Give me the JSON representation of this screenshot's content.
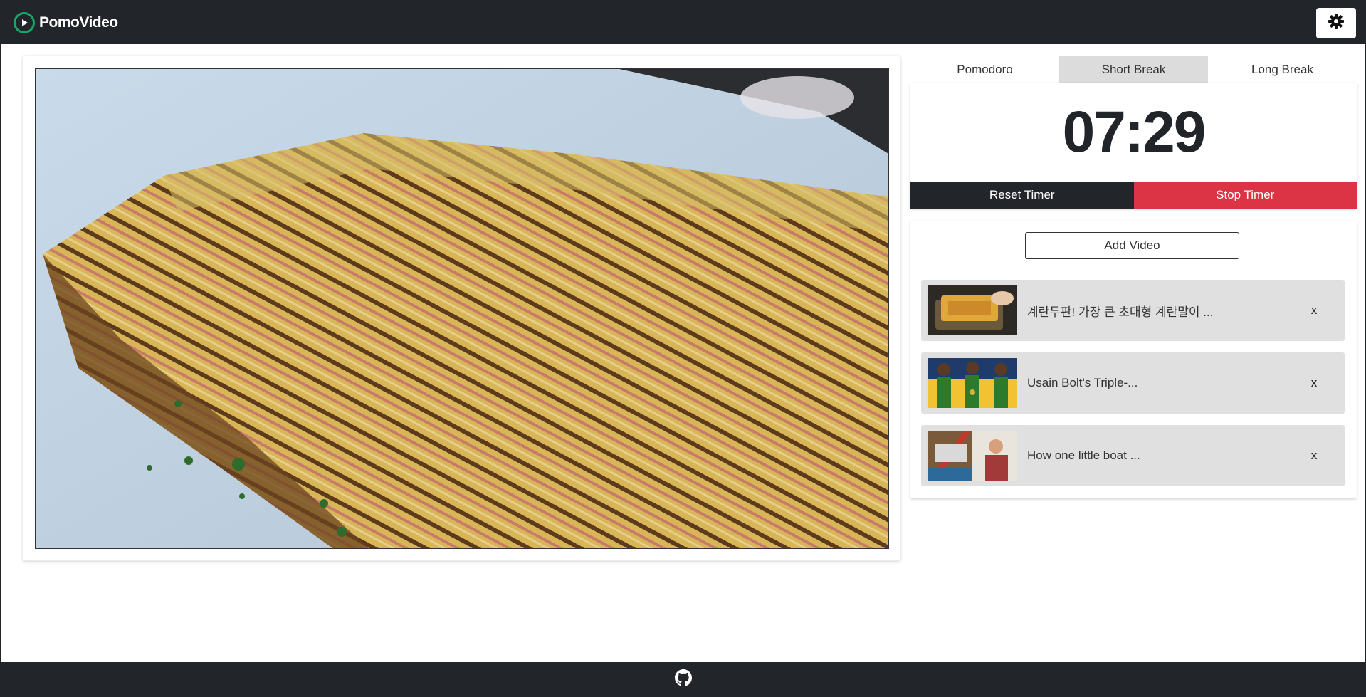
{
  "app": {
    "brand_name": "PomoVideo",
    "accent_color": "#1aa36b",
    "nav_color": "#22252a",
    "stop_color": "#dc3444"
  },
  "header": {
    "logo_icon": "play-circle-icon",
    "settings_icon": "gear-icon"
  },
  "video": {
    "content": "video-thumbnail-egg-roll"
  },
  "timer": {
    "tabs": [
      {
        "label": "Pomodoro",
        "active": false
      },
      {
        "label": "Short Break",
        "active": true
      },
      {
        "label": "Long Break",
        "active": false
      }
    ],
    "time": "07:29",
    "reset_label": "Reset Timer",
    "stop_label": "Stop Timer"
  },
  "playlist": {
    "add_label": "Add Video",
    "items": [
      {
        "title": "계란두판! 가장 큰 초대형 계란말이 ...",
        "remove_label": "x"
      },
      {
        "title": "Usain Bolt's Triple-...",
        "remove_label": "x"
      },
      {
        "title": "How one little boat ...",
        "remove_label": "x"
      }
    ]
  },
  "footer": {
    "icon": "github-icon"
  }
}
